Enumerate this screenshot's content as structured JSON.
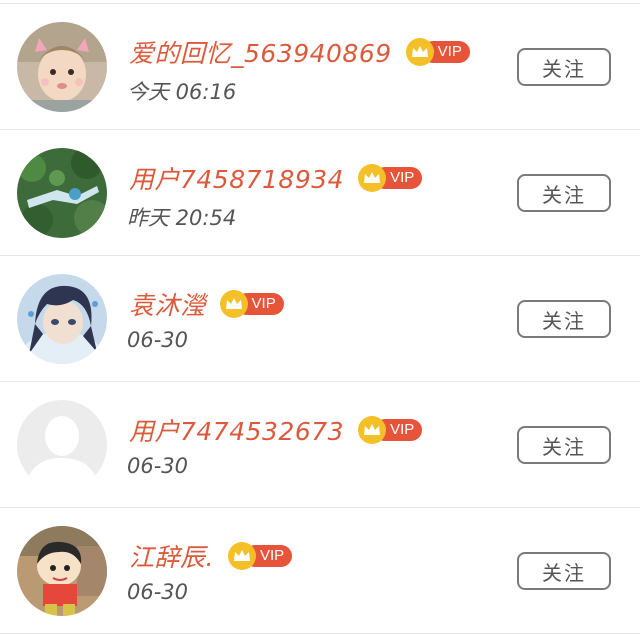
{
  "users": [
    {
      "name": "爱的回忆_563940869",
      "time": "今天 06:16",
      "vip": true,
      "vip_label": "VIP",
      "follow_label": "关注",
      "avatar": "child-photo"
    },
    {
      "name": "用户7458718934",
      "time": "昨天 20:54",
      "vip": true,
      "vip_label": "VIP",
      "follow_label": "关注",
      "avatar": "garden-photo"
    },
    {
      "name": "袁沐瀅",
      "time": "06-30",
      "vip": true,
      "vip_label": "VIP",
      "follow_label": "关注",
      "avatar": "anime-illustration"
    },
    {
      "name": "用户7474532673",
      "time": "06-30",
      "vip": true,
      "vip_label": "VIP",
      "follow_label": "关注",
      "avatar": "default-person"
    },
    {
      "name": "江辞辰.",
      "time": "06-30",
      "vip": true,
      "vip_label": "VIP",
      "follow_label": "关注",
      "avatar": "cartoon-character"
    }
  ],
  "colors": {
    "username": "#dc5a3c",
    "vip_pill": "#e6543a",
    "vip_crown": "#f4c028",
    "divider": "#e6e6e6"
  }
}
